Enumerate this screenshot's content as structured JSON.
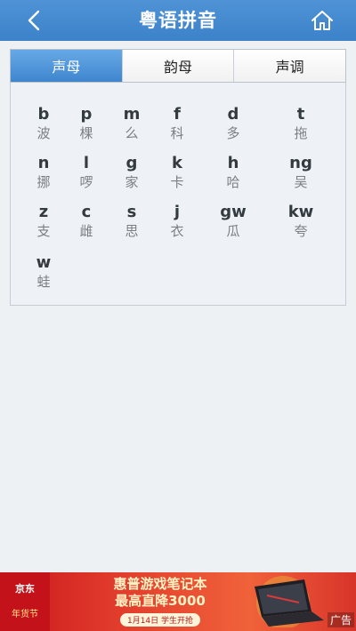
{
  "header": {
    "title": "粤语拼音",
    "back_icon": "chevron-left-icon",
    "home_icon": "home-icon",
    "color": "#4a8fd3"
  },
  "tabs": [
    {
      "label": "声母",
      "active": true
    },
    {
      "label": "韵母",
      "active": false
    },
    {
      "label": "声调",
      "active": false
    }
  ],
  "initials": [
    {
      "letter": "b",
      "char": "波"
    },
    {
      "letter": "p",
      "char": "棵"
    },
    {
      "letter": "m",
      "char": "么"
    },
    {
      "letter": "f",
      "char": "科"
    },
    {
      "letter": "d",
      "char": "多"
    },
    {
      "letter": "t",
      "char": "拖"
    },
    {
      "letter": "n",
      "char": "挪"
    },
    {
      "letter": "l",
      "char": "啰"
    },
    {
      "letter": "g",
      "char": "家"
    },
    {
      "letter": "k",
      "char": "卡"
    },
    {
      "letter": "h",
      "char": "哈"
    },
    {
      "letter": "ng",
      "char": "吴"
    },
    {
      "letter": "z",
      "char": "支"
    },
    {
      "letter": "c",
      "char": "雌"
    },
    {
      "letter": "s",
      "char": "思"
    },
    {
      "letter": "j",
      "char": "衣"
    },
    {
      "letter": "gw",
      "char": "瓜"
    },
    {
      "letter": "kw",
      "char": "夸"
    },
    {
      "letter": "w",
      "char": "蛙"
    }
  ],
  "ad": {
    "brand": "京东",
    "festival": "年货节",
    "line1": "惠普游戏笔记本",
    "line2": "最高直降3000",
    "pill": "1月14日 学生开抢",
    "tag": "广告",
    "accent": "#d8342a"
  }
}
